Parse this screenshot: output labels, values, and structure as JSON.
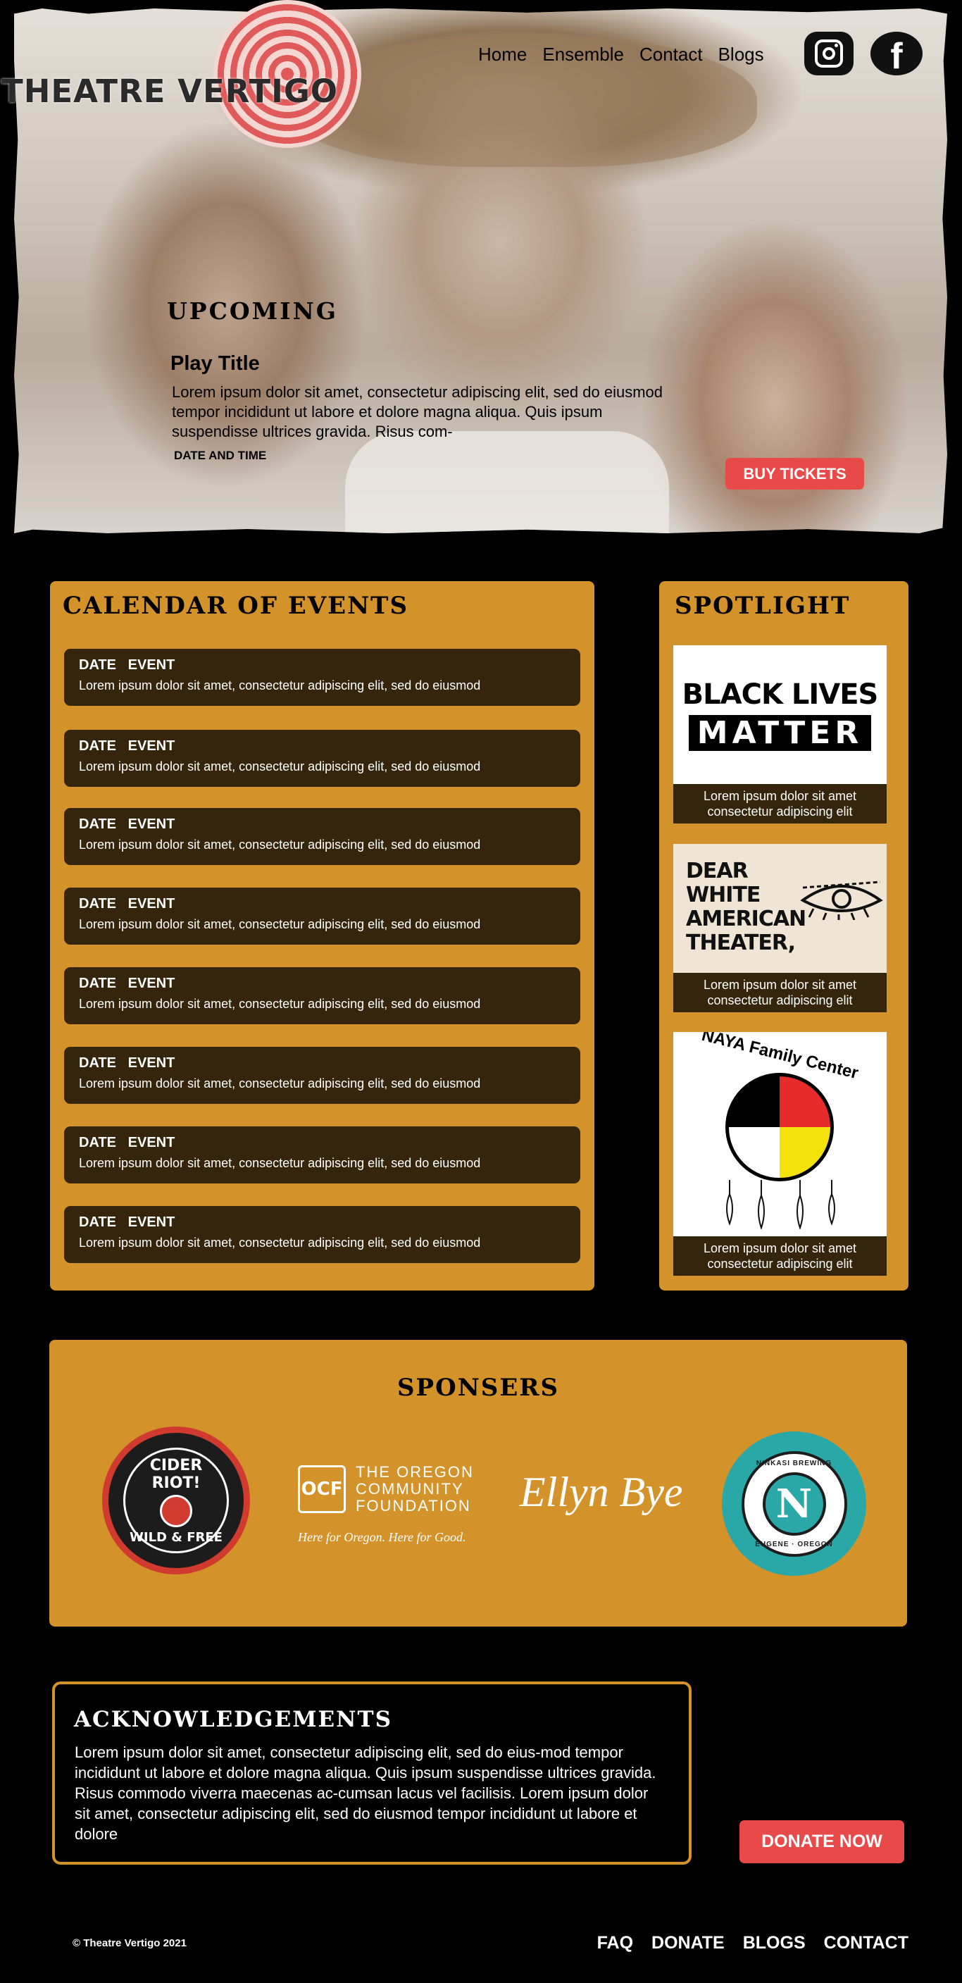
{
  "brand": {
    "name": "THEATRE VERTIGO"
  },
  "nav": {
    "items": [
      "Home",
      "Ensemble",
      "Contact",
      "Blogs"
    ]
  },
  "social": {
    "icons": [
      "instagram-icon",
      "facebook-icon"
    ]
  },
  "hero": {
    "section_title": "UPCOMING",
    "play_title": "Play Title",
    "description": "Lorem ipsum dolor sit amet, consectetur adipiscing elit, sed do eiusmod tempor incididunt ut labore et dolore magna aliqua. Quis ipsum suspendisse ultrices gravida. Risus com-",
    "date_time": "DATE AND TIME",
    "buy_label": "BUY TICKETS"
  },
  "calendar": {
    "title": "CALENDAR OF EVENTS",
    "events": [
      {
        "date": "DATE",
        "event": "EVENT",
        "desc": "Lorem ipsum dolor sit amet, consectetur adipiscing elit, sed do eiusmod"
      },
      {
        "date": "DATE",
        "event": "EVENT",
        "desc": "Lorem ipsum dolor sit amet, consectetur adipiscing elit, sed do eiusmod"
      },
      {
        "date": "DATE",
        "event": "EVENT",
        "desc": "Lorem ipsum dolor sit amet, consectetur adipiscing elit, sed do eiusmod"
      },
      {
        "date": "DATE",
        "event": "EVENT",
        "desc": "Lorem ipsum dolor sit amet, consectetur adipiscing elit, sed do eiusmod"
      },
      {
        "date": "DATE",
        "event": "EVENT",
        "desc": "Lorem ipsum dolor sit amet, consectetur adipiscing elit, sed do eiusmod"
      },
      {
        "date": "DATE",
        "event": "EVENT",
        "desc": "Lorem ipsum dolor sit amet, consectetur adipiscing elit, sed do eiusmod"
      },
      {
        "date": "DATE",
        "event": "EVENT",
        "desc": "Lorem ipsum dolor sit amet, consectetur adipiscing elit, sed do eiusmod"
      },
      {
        "date": "DATE",
        "event": "EVENT",
        "desc": "Lorem ipsum dolor sit amet, consectetur adipiscing elit, sed do eiusmod"
      }
    ]
  },
  "spotlight": {
    "title": "SPOTLIGHT",
    "cards": [
      {
        "image_line1": "BLACK LIVES",
        "image_line2": "MATTER",
        "caption": "Lorem ipsum dolor sit amet consectetur adipiscing elit"
      },
      {
        "image_line1": "DEAR",
        "image_line2": "WHITE",
        "image_line3": "AMERICAN",
        "image_line4": "THEATER,",
        "caption": "Lorem ipsum dolor sit amet consectetur adipiscing elit"
      },
      {
        "image_line1": "NAYA Family Center",
        "caption": "Lorem ipsum dolor sit amet consectetur adipiscing elit"
      }
    ]
  },
  "sponsors": {
    "title": "SPONSERS",
    "cider": {
      "line1": "CIDER RIOT!",
      "line2": "WILD & FREE"
    },
    "ocf": {
      "mark": "OCF",
      "line1": "THE OREGON",
      "line2": "COMMUNITY",
      "line3": "FOUNDATION",
      "tagline": "Here for Oregon. Here for Good."
    },
    "ellyn": {
      "name": "Ellyn Bye"
    },
    "ninkasi": {
      "letter": "N",
      "top": "NINKASI BREWING",
      "bottom": "EUGENE · OREGON"
    }
  },
  "acknowledgements": {
    "title": "ACKNOWLEDGEMENTS",
    "body": "Lorem ipsum dolor sit amet, consectetur adipiscing elit, sed do eius-mod tempor incididunt ut labore et dolore magna aliqua. Quis ipsum suspendisse ultrices gravida. Risus commodo viverra maecenas ac-cumsan lacus vel facilisis. Lorem ipsum dolor sit amet, consectetur adipiscing elit, sed do eiusmod tempor incididunt ut labore et dolore"
  },
  "donate": {
    "label": "DONATE NOW"
  },
  "footer": {
    "copyright": "© Theatre Vertigo 2021",
    "links": [
      "FAQ",
      "DONATE",
      "BLOGS",
      "CONTACT"
    ]
  },
  "colors": {
    "panel": "#d4932a",
    "dark_card": "#35250c",
    "button": "#e84a4a",
    "background": "#000000"
  }
}
